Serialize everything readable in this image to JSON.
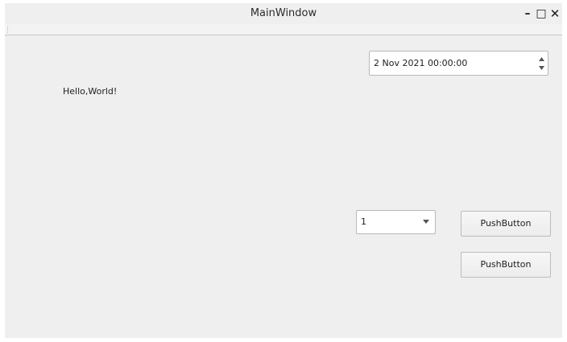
{
  "window": {
    "title": "MainWindow",
    "controls": {
      "minimize": "–",
      "maximize": "□",
      "close": "✕"
    },
    "minimize_icon": "minimize-icon",
    "maximize_icon": "maximize-icon",
    "close_icon": "close-icon"
  },
  "content": {
    "label_text": "Hello,World!",
    "datetime": {
      "value": "2 Nov 2021 00:00:00"
    },
    "combobox": {
      "selected": "1"
    },
    "buttons": [
      {
        "label": "PushButton"
      },
      {
        "label": "PushButton"
      }
    ]
  },
  "colors": {
    "background": "#efefef",
    "field": "#ffffff",
    "border": "#b9b9b9"
  }
}
